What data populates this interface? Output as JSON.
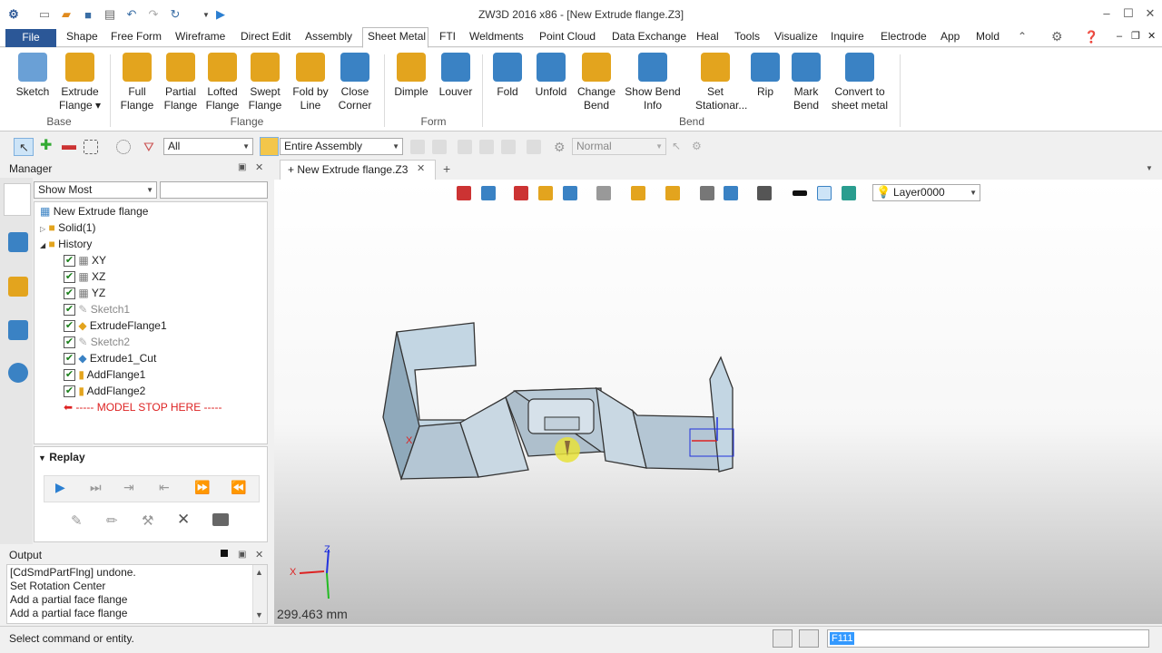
{
  "window": {
    "title": "ZW3D 2016  x86 - [New Extrude flange.Z3]"
  },
  "menus": [
    "File",
    "Shape",
    "Free Form",
    "Wireframe",
    "Direct Edit",
    "Assembly",
    "Sheet Metal",
    "FTI",
    "Weldments",
    "Point Cloud",
    "Data Exchange",
    "Heal",
    "Tools",
    "Visualize",
    "Inquire",
    "Electrode",
    "App",
    "Mold"
  ],
  "ribbon": {
    "buttons": [
      {
        "l1": "Sketch",
        "l2": ""
      },
      {
        "l1": "Extrude",
        "l2": "Flange ▾"
      },
      {
        "l1": "Full",
        "l2": "Flange"
      },
      {
        "l1": "Partial",
        "l2": "Flange"
      },
      {
        "l1": "Lofted",
        "l2": "Flange"
      },
      {
        "l1": "Swept",
        "l2": "Flange"
      },
      {
        "l1": "Fold by",
        "l2": "Line"
      },
      {
        "l1": "Close",
        "l2": "Corner"
      },
      {
        "l1": "Dimple",
        "l2": ""
      },
      {
        "l1": "Louver",
        "l2": ""
      },
      {
        "l1": "Fold",
        "l2": ""
      },
      {
        "l1": "Unfold",
        "l2": ""
      },
      {
        "l1": "Change",
        "l2": "Bend"
      },
      {
        "l1": "Show Bend",
        "l2": "Info"
      },
      {
        "l1": "Set",
        "l2": "Stationar..."
      },
      {
        "l1": "Rip",
        "l2": ""
      },
      {
        "l1": "Mark",
        "l2": "Bend"
      },
      {
        "l1": "Convert to",
        "l2": "sheet metal"
      }
    ],
    "groups": [
      "Base",
      "Flange",
      "Form",
      "Bend"
    ]
  },
  "toolbar": {
    "filter": "All",
    "scope": "Entire Assembly",
    "mode": "Normal"
  },
  "manager": {
    "title": "Manager",
    "show": "Show Most",
    "root": "New Extrude flange",
    "solid": "Solid(1)",
    "history": "History",
    "items": [
      "XY",
      "XZ",
      "YZ",
      "Sketch1",
      "ExtrudeFlange1",
      "Sketch2",
      "Extrude1_Cut",
      "AddFlange1",
      "AddFlange2"
    ],
    "stop": "----- MODEL STOP HERE -----",
    "replay": "Replay"
  },
  "doc_tab": "New Extrude flange.Z3",
  "layer": "Layer0000",
  "measure": "299.463 mm",
  "output": {
    "title": "Output",
    "lines": [
      "[CdSmdPartFlng] undone.",
      "Set Rotation Center",
      "Add a partial face flange",
      "Add a partial face flange"
    ]
  },
  "status": {
    "text": "Select command or entity.",
    "field": "F111"
  },
  "axes": {
    "x": "X",
    "z": "Z"
  },
  "colors": {
    "accent": "#2b5797",
    "file_menu": "#2b5797"
  }
}
